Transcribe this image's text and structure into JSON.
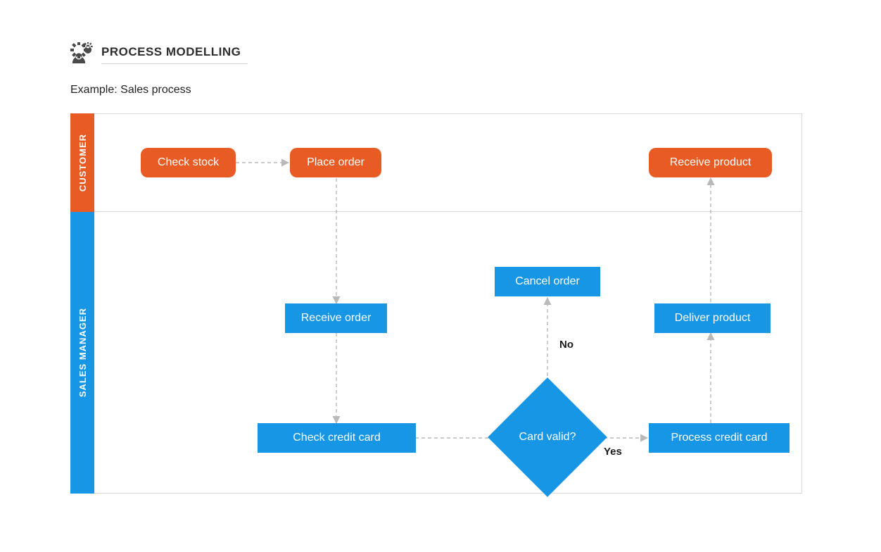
{
  "header": {
    "title": "PROCESS MODELLING",
    "subtitle": "Example: Sales process"
  },
  "lanes": {
    "customer": "CUSTOMER",
    "sales": "SALES MANAGER"
  },
  "nodes": {
    "check_stock": "Check stock",
    "place_order": "Place order",
    "receive_product": "Receive product",
    "receive_order": "Receive order",
    "check_credit_card": "Check credit card",
    "card_valid": "Card valid?",
    "cancel_order": "Cancel order",
    "process_credit_card": "Process credit card",
    "deliver_product": "Deliver product"
  },
  "edges": {
    "no": "No",
    "yes": "Yes"
  },
  "colors": {
    "orange": "#e85b24",
    "blue": "#1896e6",
    "border": "#d9d9d9",
    "arrow": "#b9b9b9"
  },
  "diagram": {
    "type": "swimlane_flowchart",
    "lanes": [
      "CUSTOMER",
      "SALES MANAGER"
    ],
    "nodes": [
      {
        "id": "check_stock",
        "lane": "CUSTOMER",
        "shape": "rounded-rect",
        "label": "Check stock"
      },
      {
        "id": "place_order",
        "lane": "CUSTOMER",
        "shape": "rounded-rect",
        "label": "Place order"
      },
      {
        "id": "receive_product",
        "lane": "CUSTOMER",
        "shape": "rounded-rect",
        "label": "Receive product"
      },
      {
        "id": "receive_order",
        "lane": "SALES MANAGER",
        "shape": "rect",
        "label": "Receive order"
      },
      {
        "id": "check_credit_card",
        "lane": "SALES MANAGER",
        "shape": "rect",
        "label": "Check credit card"
      },
      {
        "id": "card_valid",
        "lane": "SALES MANAGER",
        "shape": "diamond",
        "label": "Card valid?"
      },
      {
        "id": "cancel_order",
        "lane": "SALES MANAGER",
        "shape": "rect",
        "label": "Cancel order"
      },
      {
        "id": "process_credit_card",
        "lane": "SALES MANAGER",
        "shape": "rect",
        "label": "Process credit card"
      },
      {
        "id": "deliver_product",
        "lane": "SALES MANAGER",
        "shape": "rect",
        "label": "Deliver product"
      }
    ],
    "edges": [
      {
        "from": "check_stock",
        "to": "place_order"
      },
      {
        "from": "place_order",
        "to": "receive_order"
      },
      {
        "from": "receive_order",
        "to": "check_credit_card"
      },
      {
        "from": "check_credit_card",
        "to": "card_valid"
      },
      {
        "from": "card_valid",
        "to": "cancel_order",
        "label": "No"
      },
      {
        "from": "card_valid",
        "to": "process_credit_card",
        "label": "Yes"
      },
      {
        "from": "process_credit_card",
        "to": "deliver_product"
      },
      {
        "from": "deliver_product",
        "to": "receive_product"
      }
    ]
  }
}
